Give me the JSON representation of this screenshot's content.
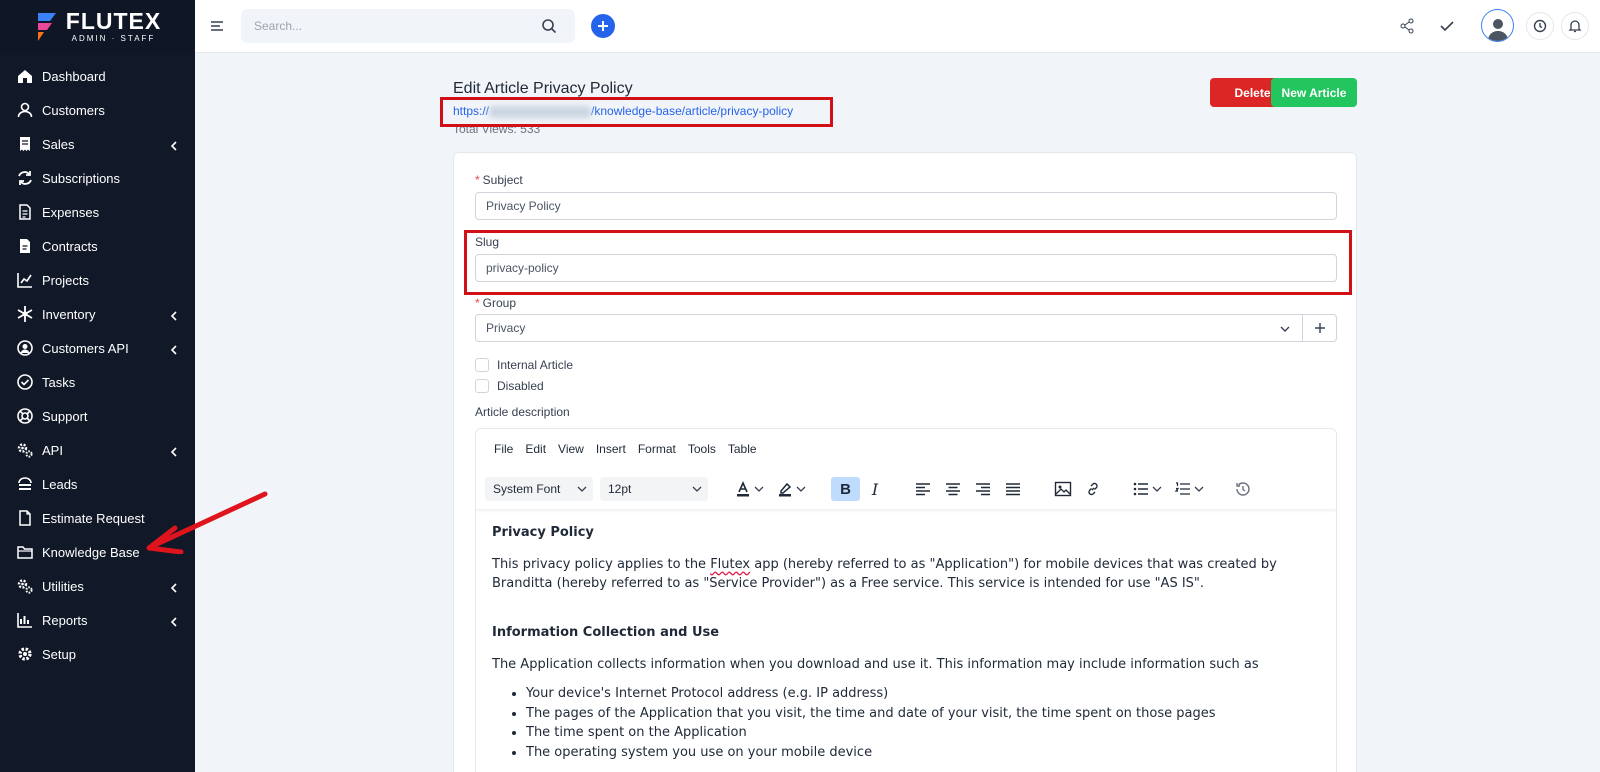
{
  "brand": {
    "name": "FLUTEX",
    "subtitle": "ADMIN · STAFF"
  },
  "sidebar": {
    "items": [
      {
        "label": "Dashboard",
        "icon": "home-icon",
        "chevron": false
      },
      {
        "label": "Customers",
        "icon": "user-icon",
        "chevron": false
      },
      {
        "label": "Sales",
        "icon": "receipt-icon",
        "chevron": true
      },
      {
        "label": "Subscriptions",
        "icon": "repeat-icon",
        "chevron": false
      },
      {
        "label": "Expenses",
        "icon": "file-text-icon",
        "chevron": false
      },
      {
        "label": "Contracts",
        "icon": "contract-icon",
        "chevron": false
      },
      {
        "label": "Projects",
        "icon": "chart-line-icon",
        "chevron": false
      },
      {
        "label": "Inventory",
        "icon": "snowflake-icon",
        "chevron": true
      },
      {
        "label": "Customers API",
        "icon": "api-user-icon",
        "chevron": true
      },
      {
        "label": "Tasks",
        "icon": "check-circle-icon",
        "chevron": false
      },
      {
        "label": "Support",
        "icon": "lifebuoy-icon",
        "chevron": false
      },
      {
        "label": "API",
        "icon": "gears-icon",
        "chevron": true
      },
      {
        "label": "Leads",
        "icon": "leads-icon",
        "chevron": false
      },
      {
        "label": "Estimate Request",
        "icon": "document-icon",
        "chevron": false
      },
      {
        "label": "Knowledge Base",
        "icon": "folder-icon",
        "chevron": false
      },
      {
        "label": "Utilities",
        "icon": "gears-icon",
        "chevron": true
      },
      {
        "label": "Reports",
        "icon": "bar-chart-icon",
        "chevron": true
      },
      {
        "label": "Setup",
        "icon": "gear-icon",
        "chevron": false
      }
    ]
  },
  "topbar": {
    "search_placeholder": "Search...",
    "icons": [
      "menu-icon",
      "search-icon",
      "plus-icon",
      "share-icon",
      "check-icon",
      "avatar",
      "clock-icon",
      "bell-icon"
    ]
  },
  "page": {
    "title": "Edit Article Privacy Policy",
    "url_prefix": "https://",
    "url_suffix": "/knowledge-base/article/privacy-policy",
    "total_views": "Total Views: 533",
    "delete_label": "Delete",
    "new_article_label": "New Article"
  },
  "form": {
    "subject_label": "Subject",
    "subject_value": "Privacy Policy",
    "slug_label": "Slug",
    "slug_value": "privacy-policy",
    "group_label": "Group",
    "group_value": "Privacy",
    "internal_label": "Internal Article",
    "disabled_label": "Disabled",
    "description_label": "Article description"
  },
  "editor": {
    "menus": [
      "File",
      "Edit",
      "View",
      "Insert",
      "Format",
      "Tools",
      "Table"
    ],
    "font_family": "System Font",
    "font_size": "12pt",
    "content": {
      "heading1": "Privacy Policy",
      "para1_before": "This privacy policy applies to the ",
      "para1_spell": "Flutex",
      "para1_after": " app (hereby referred to as \"Application\") for mobile devices that was created by Branditta (hereby referred to as \"Service Provider\") as a Free service. This service is intended for use \"AS IS\".",
      "heading2": "Information Collection and Use",
      "para2": "The Application collects information when you download and use it. This information may include information such as",
      "list": [
        "Your device's Internet Protocol address (e.g. IP address)",
        "The pages of the Application that you visit, the time and date of your visit, the time spent on those pages",
        "The time spent on the Application",
        "The operating system you use on your mobile device"
      ]
    }
  },
  "colors": {
    "sidebar_bg": "#111827",
    "accent_blue": "#2563eb",
    "delete_red": "#dc2626",
    "new_green": "#22c55e",
    "highlight_red": "#d10f17"
  }
}
